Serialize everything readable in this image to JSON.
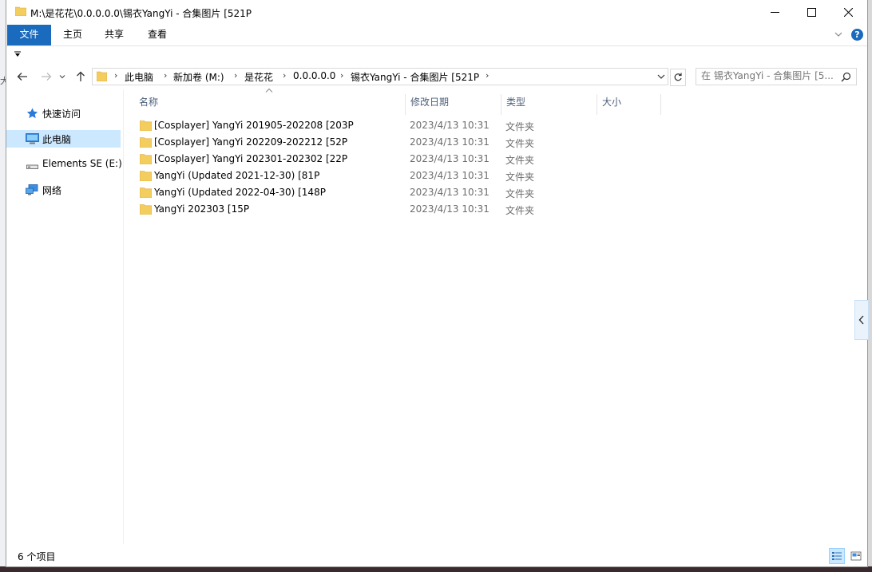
{
  "titlebar": {
    "title": "M:\\是花花\\0.0.0.0.0\\锡衣YangYi - 合集图片 [521P"
  },
  "ribbon": {
    "tabs": [
      "文件",
      "主页",
      "共享",
      "查看"
    ],
    "help": "?"
  },
  "addressbar": {
    "crumbs": [
      "此电脑",
      "新加卷 (M:)",
      "是花花",
      "0.0.0.0.0",
      "锡衣YangYi - 合集图片 [521P"
    ]
  },
  "search": {
    "placeholder": "在 锡衣YangYi - 合集图片 [5..."
  },
  "navpane": {
    "items": [
      {
        "label": "快速访问",
        "icon": "star-icon"
      },
      {
        "label": "此电脑",
        "icon": "computer-icon",
        "selected": true
      },
      {
        "label": "Elements SE (E:)",
        "icon": "drive-icon"
      },
      {
        "label": "网络",
        "icon": "network-icon"
      }
    ]
  },
  "columns": [
    "名称",
    "修改日期",
    "类型",
    "大小"
  ],
  "files": [
    {
      "name": "[Cosplayer] YangYi 201905-202208 [203P",
      "date": "2023/4/13 10:31",
      "type": "文件夹"
    },
    {
      "name": "[Cosplayer] YangYi 202209-202212 [52P",
      "date": "2023/4/13 10:31",
      "type": "文件夹"
    },
    {
      "name": "[Cosplayer] YangYi 202301-202302 [22P",
      "date": "2023/4/13 10:31",
      "type": "文件夹"
    },
    {
      "name": "YangYi (Updated 2021-12-30) [81P",
      "date": "2023/4/13 10:31",
      "type": "文件夹"
    },
    {
      "name": "YangYi (Updated 2022-04-30) [148P",
      "date": "2023/4/13 10:31",
      "type": "文件夹"
    },
    {
      "name": "YangYi 202303 [15P",
      "date": "2023/4/13 10:31",
      "type": "文件夹"
    }
  ],
  "status": {
    "count_text": "6 个项目"
  },
  "background": {
    "edge_text": "大"
  },
  "colors": {
    "accent": "#1a6bbd",
    "selected": "#cce8ff",
    "folder": "#f3cd5e",
    "column_header": "#4c607a"
  }
}
